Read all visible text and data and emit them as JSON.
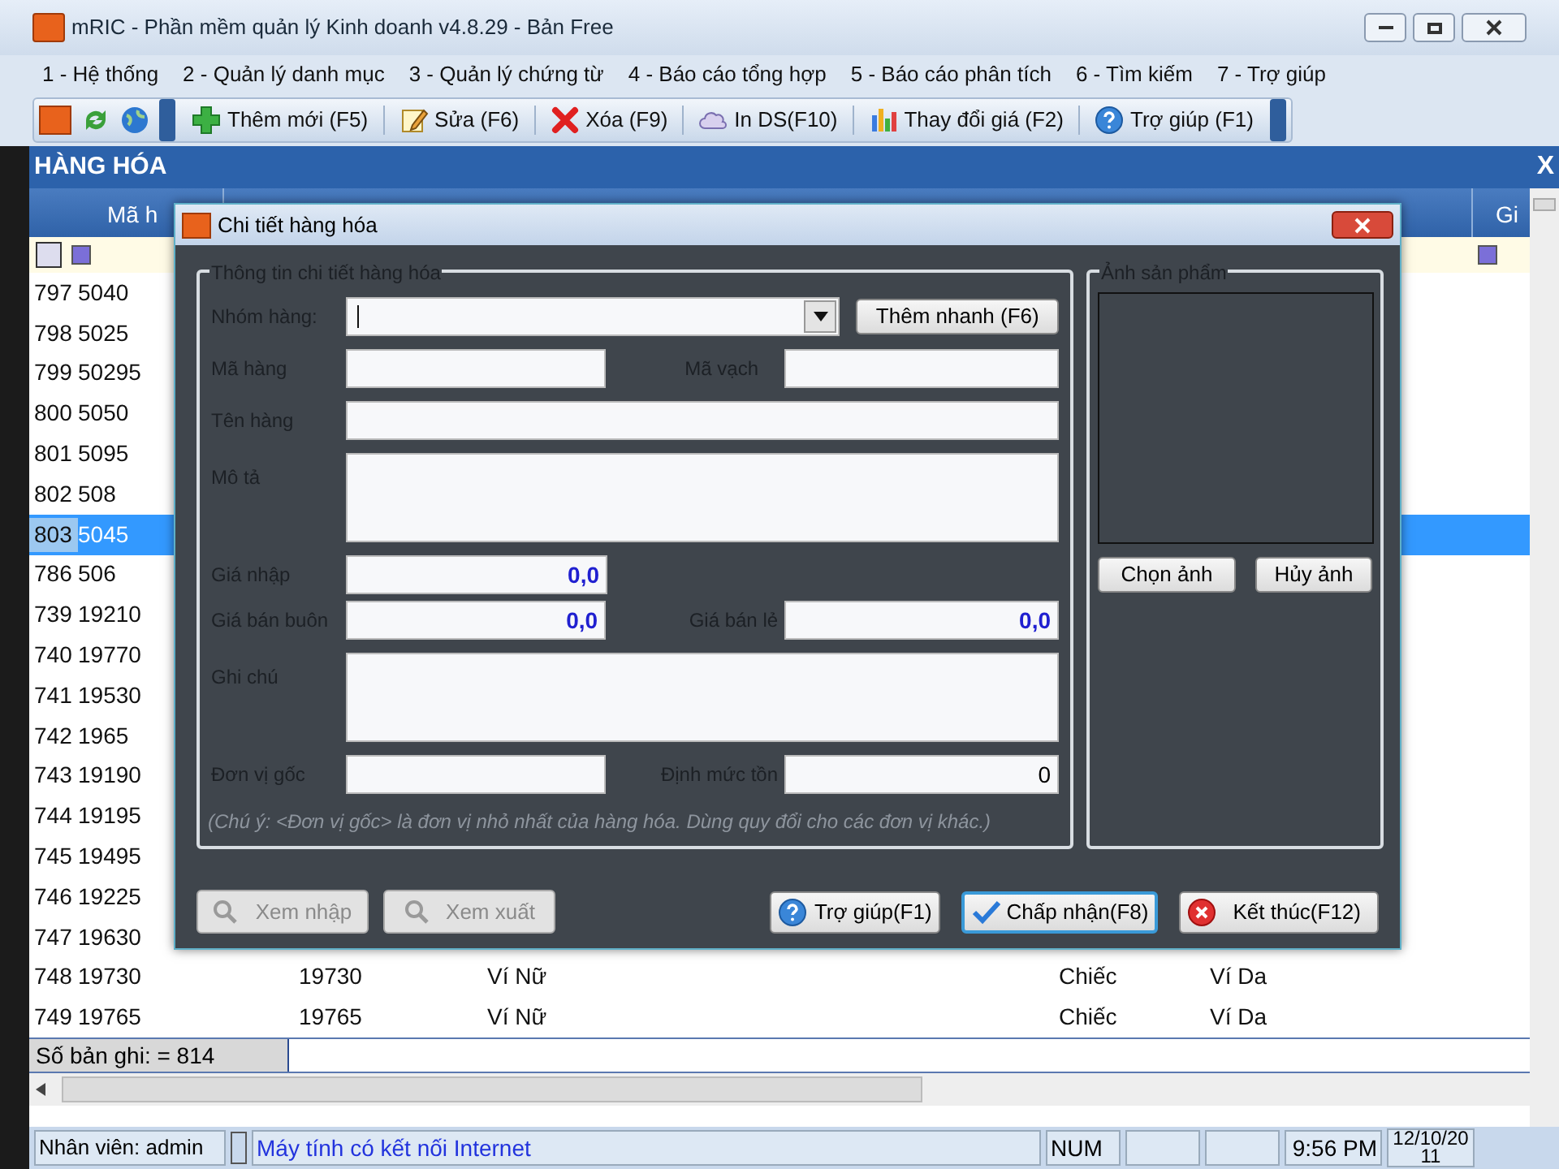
{
  "window": {
    "title": "mRIC - Phần mềm quản lý Kinh doanh v4.8.29 - Bản Free"
  },
  "menu": [
    "1 - Hệ thống",
    "2 - Quản lý danh mục",
    "3 - Quản lý chứng từ",
    "4 - Báo cáo tổng hợp",
    "5 - Báo cáo phân tích",
    "6 - Tìm kiếm",
    "7 - Trợ giúp"
  ],
  "toolbar": [
    {
      "kind": "add",
      "label": "Thêm mới (F5)"
    },
    {
      "kind": "edit",
      "label": "Sửa (F6)"
    },
    {
      "kind": "delete",
      "label": "Xóa (F9)"
    },
    {
      "kind": "print",
      "label": "In DS(F10)"
    },
    {
      "kind": "price",
      "label": "Thay đổi giá (F2)"
    },
    {
      "kind": "help",
      "label": "Trợ giúp (F1)"
    }
  ],
  "panel": {
    "title": "HÀNG HÓA",
    "close": "X"
  },
  "table": {
    "columns": [
      "Mã h",
      "Gi"
    ],
    "rows": [
      {
        "number": "797",
        "code": "5040",
        "selected": false
      },
      {
        "number": "798",
        "code": "5025",
        "selected": false
      },
      {
        "number": "799",
        "code": "50295",
        "selected": false
      },
      {
        "number": "800",
        "code": "5050",
        "selected": false
      },
      {
        "number": "801",
        "code": "5095",
        "selected": false
      },
      {
        "number": "802",
        "code": "508",
        "selected": false
      },
      {
        "number": "803",
        "code": "5045",
        "selected": true
      },
      {
        "number": "786",
        "code": "506",
        "selected": false
      },
      {
        "number": "739",
        "code": "19210",
        "selected": false
      },
      {
        "number": "740",
        "code": "19770",
        "selected": false
      },
      {
        "number": "741",
        "code": "19530",
        "selected": false
      },
      {
        "number": "742",
        "code": "1965",
        "selected": false
      },
      {
        "number": "743",
        "code": "19190",
        "selected": false
      },
      {
        "number": "744",
        "code": "19195",
        "selected": false
      },
      {
        "number": "745",
        "code": "19495",
        "selected": false
      },
      {
        "number": "746",
        "code": "19225",
        "selected": false
      },
      {
        "number": "747",
        "code": "19630",
        "selected": false
      },
      {
        "number": "748",
        "code": "19730",
        "selected": false,
        "barcode": "19730",
        "name": "Ví Nữ",
        "unit": "Chiếc",
        "group": "Ví Da"
      },
      {
        "number": "749",
        "code": "19765",
        "selected": false,
        "barcode": "19765",
        "name": "Ví Nữ",
        "unit": "Chiếc",
        "group": "Ví Da"
      }
    ],
    "record_count": "Số bản ghi: = 814"
  },
  "status_bar": {
    "user": "Nhân viên: admin",
    "network": "Máy tính có kết nối Internet",
    "num": "NUM",
    "time": "9:56 PM",
    "date": "12/10/2011"
  },
  "dialog": {
    "title": "Chi tiết hàng hóa",
    "details_group": "Thông tin chi tiết hàng hóa",
    "group_field": {
      "label": "Nhóm hàng:",
      "button": "Thêm nhanh (F6)"
    },
    "code": {
      "label": "Mã hàng"
    },
    "barcode": {
      "label": "Mã vạch"
    },
    "name": {
      "label": "Tên hàng"
    },
    "description": {
      "label": "Mô tả"
    },
    "purchase_price": {
      "label": "Giá nhập",
      "value": "0,0"
    },
    "wholesale_price": {
      "label": "Giá bán buôn",
      "value": "0,0"
    },
    "retail_price": {
      "label": "Giá bán lẻ",
      "value": "0,0"
    },
    "note": {
      "label": "Ghi chú"
    },
    "base_unit": {
      "label": "Đơn vị gốc"
    },
    "min_stock": {
      "label": "Định mức tồn",
      "value": "0"
    },
    "hint": "(Chú ý: <Đơn vị gốc> là đơn vị nhỏ nhất của hàng hóa. Dùng quy đổi cho các đơn vị khác.)",
    "photo_group": "Ảnh sản phẩm",
    "photo_buttons": [
      "Chọn ảnh",
      "Hủy ảnh"
    ],
    "left_buttons": [
      {
        "label": "Xem nhập",
        "disabled": true
      },
      {
        "label": "Xem xuất",
        "disabled": true
      }
    ],
    "buttons": [
      {
        "kind": "help",
        "label": "Trợ giúp(F1)",
        "focused": false
      },
      {
        "kind": "accept",
        "label": "Chấp nhận(F8)",
        "focused": true
      },
      {
        "kind": "close",
        "label": "Kết thúc(F12)",
        "focused": false
      }
    ]
  }
}
